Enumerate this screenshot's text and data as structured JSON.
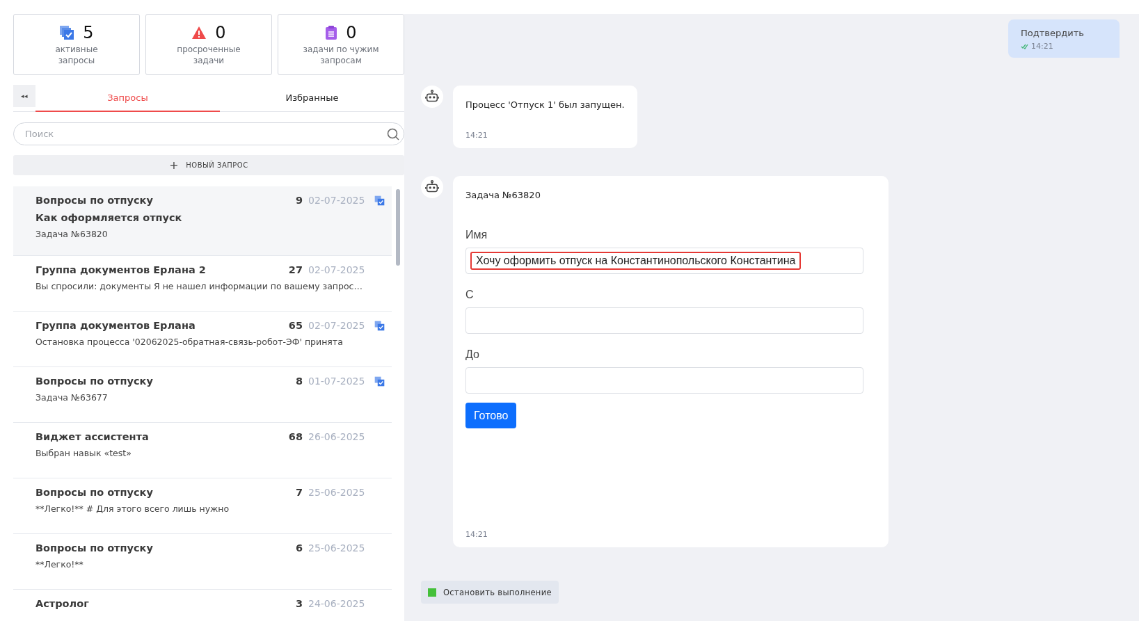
{
  "stats": [
    {
      "kind": "active",
      "count": "5",
      "label": "активные запросы"
    },
    {
      "kind": "overdue",
      "count": "0",
      "label": "просроченные задачи"
    },
    {
      "kind": "foreign",
      "count": "0",
      "label": "задачи по чужим запросам"
    }
  ],
  "collapse_button": "◂◂",
  "tabs": [
    {
      "label": "Запросы",
      "selected": true
    },
    {
      "label": "Избранные",
      "selected": false
    }
  ],
  "search": {
    "placeholder": "Поиск"
  },
  "new_request": {
    "icon": "+",
    "label": "НОВЫЙ ЗАПРОС"
  },
  "requests": [
    {
      "title": "Вопросы по отпуску",
      "subtitle": "Как оформляется отпуск",
      "preview": "Задача №63820",
      "count": "9",
      "date": "02-07-2025",
      "flagged": true,
      "selected": true
    },
    {
      "title": "Группа документов Ерлана 2",
      "preview": "Вы спросили: документы Я не нашел информации по вашему запрос…",
      "count": "27",
      "date": "02-07-2025",
      "flagged": false,
      "selected": false
    },
    {
      "title": "Группа документов Ерлана",
      "preview": "Остановка процесса '02062025-обратная-связь-робот-ЭФ' принята",
      "count": "65",
      "date": "02-07-2025",
      "flagged": true,
      "selected": false
    },
    {
      "title": "Вопросы по отпуску",
      "preview": "Задача №63677",
      "count": "8",
      "date": "01-07-2025",
      "flagged": true,
      "selected": false
    },
    {
      "title": "Виджет ассистента",
      "preview": "Выбран навык «test»",
      "count": "68",
      "date": "26-06-2025",
      "flagged": false,
      "selected": false
    },
    {
      "title": "Вопросы по отпуску",
      "preview": "**Легко!** # Для этого всего лишь нужно",
      "count": "7",
      "date": "25-06-2025",
      "flagged": false,
      "selected": false
    },
    {
      "title": "Вопросы по отпуску",
      "preview": "**Легко!**",
      "count": "6",
      "date": "25-06-2025",
      "flagged": false,
      "selected": false
    },
    {
      "title": "Астролог",
      "count": "3",
      "date": "24-06-2025",
      "flagged": false,
      "selected": false
    }
  ],
  "chat": {
    "messages": [
      {
        "kind": "user",
        "text": "Подтвердить",
        "time": "14:21",
        "read": true
      },
      {
        "kind": "bot",
        "text": "Процесс 'Отпуск 1' был запущен.",
        "time": "14:21"
      },
      {
        "kind": "form",
        "title": "Задача №63820",
        "fields": [
          {
            "label": "Имя",
            "value": "Хочу оформить отпуск на Константинопольского Константина",
            "highlighted": true
          },
          {
            "label": "С"
          },
          {
            "label": "До"
          }
        ],
        "submit": "Готово",
        "time": "14:21"
      }
    ],
    "stop_button": {
      "label": "Остановить выполнение",
      "color": "#44c03a"
    }
  }
}
